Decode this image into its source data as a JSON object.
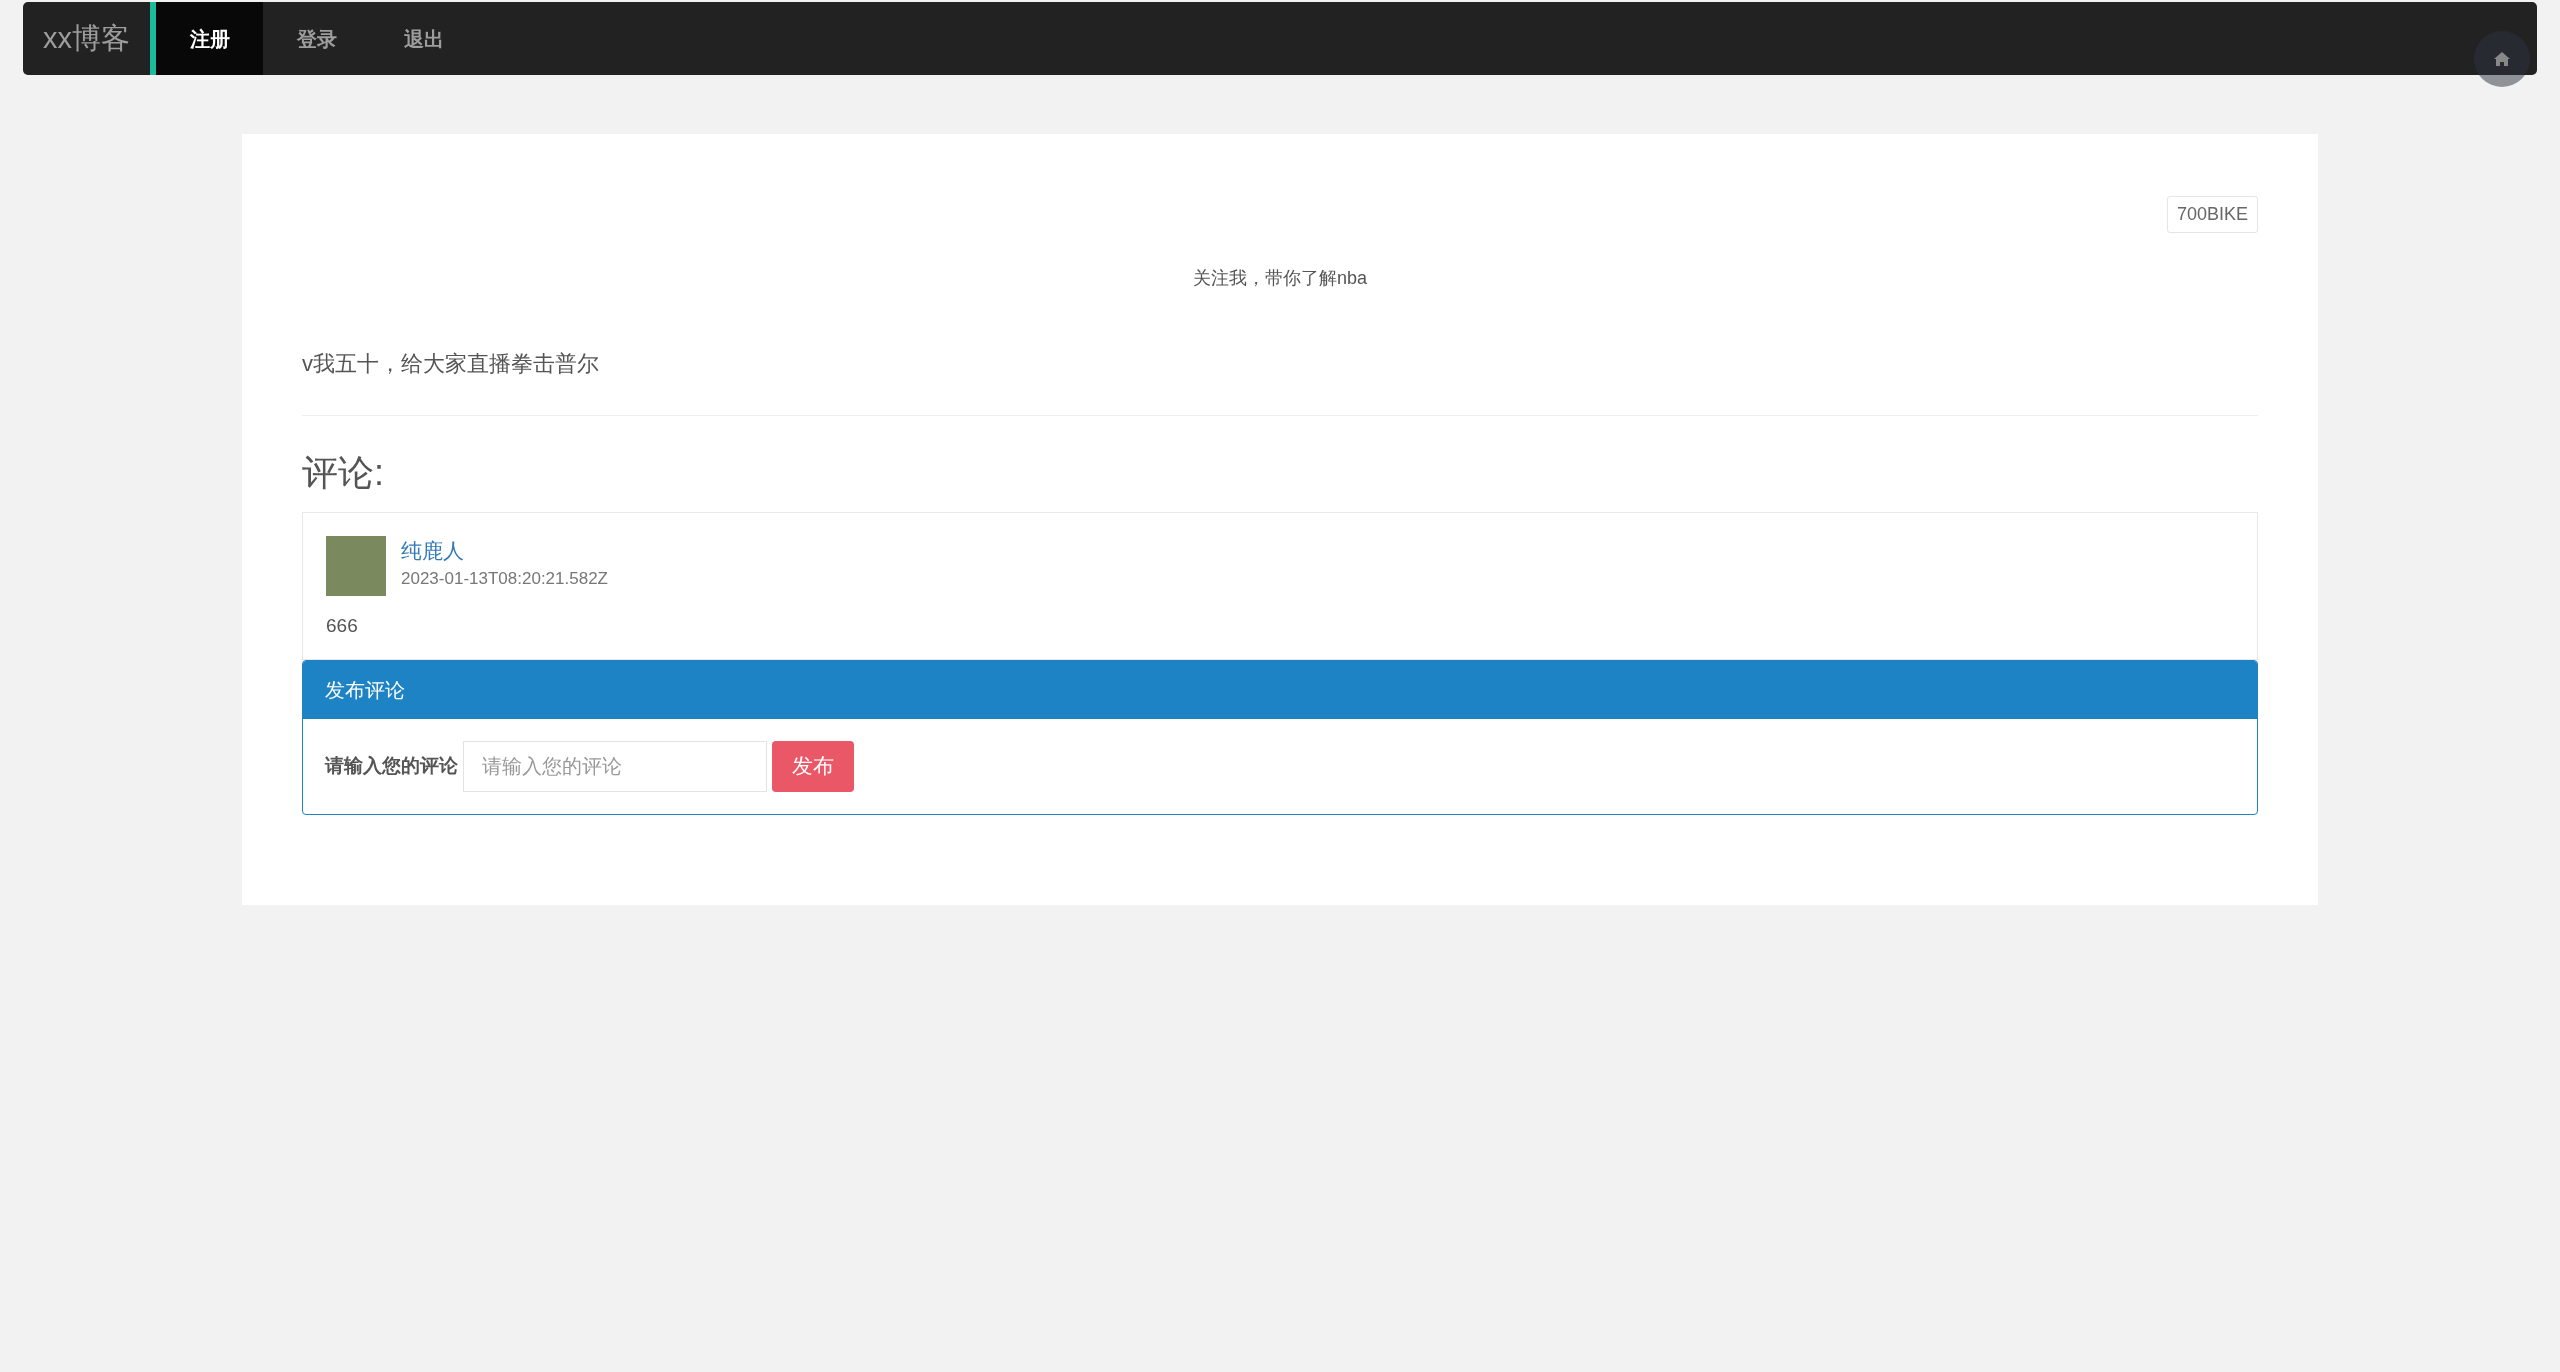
{
  "navbar": {
    "brand": "xx博客",
    "tabs": [
      {
        "label": "注册",
        "selected": true
      },
      {
        "label": "登录",
        "selected": false
      },
      {
        "label": "退出",
        "selected": false
      }
    ]
  },
  "post": {
    "tag": "700BIKE",
    "subtitle": "关注我，带你了解nba",
    "body": "v我五十，给大家直播拳击普尔"
  },
  "comments_heading": "评论:",
  "comments": [
    {
      "author": "纯鹿人",
      "time": "2023-01-13T08:20:21.582Z",
      "text": "666"
    }
  ],
  "comment_form": {
    "title": "发布评论",
    "label": "请输入您的评论",
    "placeholder": "请输入您的评论",
    "button": "发布"
  }
}
